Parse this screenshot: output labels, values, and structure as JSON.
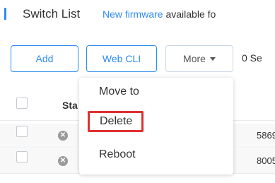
{
  "header": {
    "title": "Switch List",
    "firmware_link": "New firmware",
    "firmware_text": " available fo"
  },
  "toolbar": {
    "add_label": "Add",
    "webcli_label": "Web CLI",
    "more_label": "More",
    "selected_text": "0 Se"
  },
  "table": {
    "columns": [
      "Sta"
    ],
    "rows": [
      {
        "status": "offline",
        "id": "5869"
      },
      {
        "status": "offline",
        "id": "8005"
      }
    ]
  },
  "dropdown": {
    "items": [
      "Move to",
      "Delete",
      "Reboot"
    ],
    "highlighted": "Delete"
  },
  "colors": {
    "accent": "#2d8cf0",
    "highlight_box": "#e03131",
    "status_offline": "#9a9a9a"
  }
}
